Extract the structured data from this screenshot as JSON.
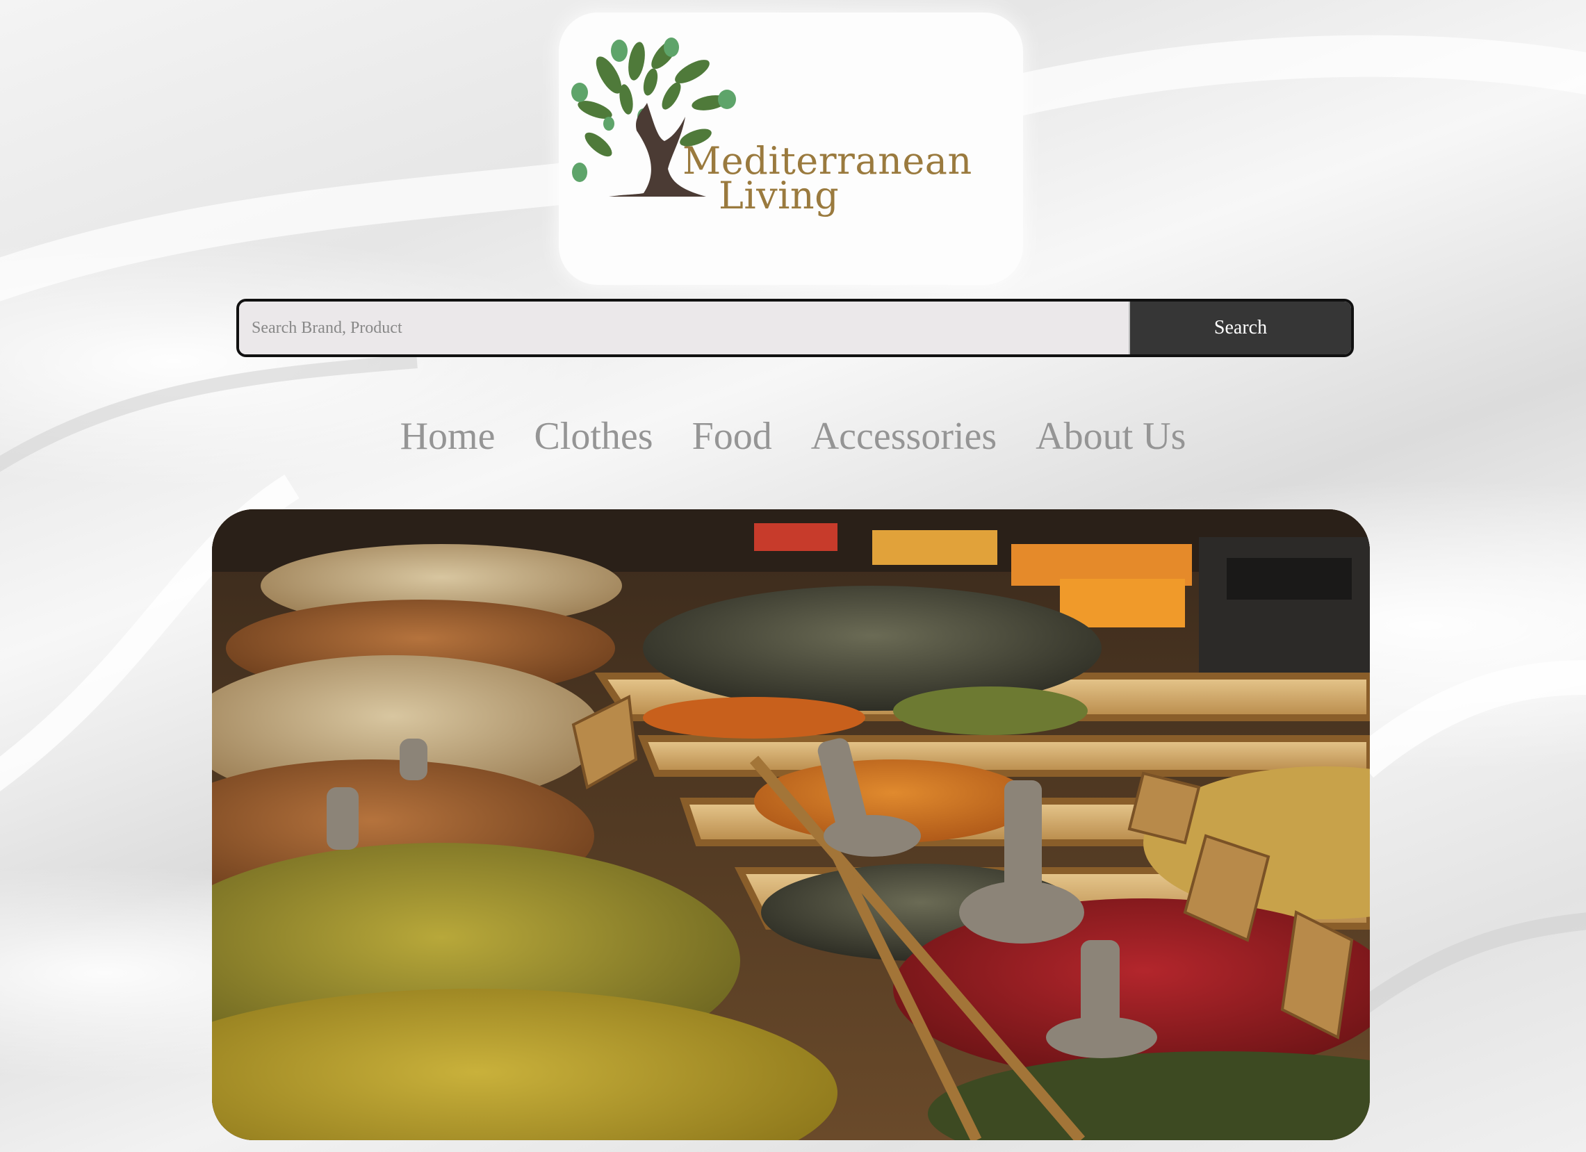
{
  "logo": {
    "line1": "Mediterranean",
    "line2": "Living",
    "icon": "olive-tree-icon",
    "colors": {
      "leaf": "#4f7a3a",
      "olive": "#5ea46a",
      "trunk": "#4b3b34",
      "text": "#9a7a3e"
    }
  },
  "search": {
    "placeholder": "Search Brand, Product",
    "value": "",
    "button_label": "Search"
  },
  "nav": {
    "items": [
      {
        "label": "Home"
      },
      {
        "label": "Clothes"
      },
      {
        "label": "Food"
      },
      {
        "label": "Accessories"
      },
      {
        "label": "About Us"
      }
    ]
  },
  "hero": {
    "subject": "spice-market-image"
  }
}
